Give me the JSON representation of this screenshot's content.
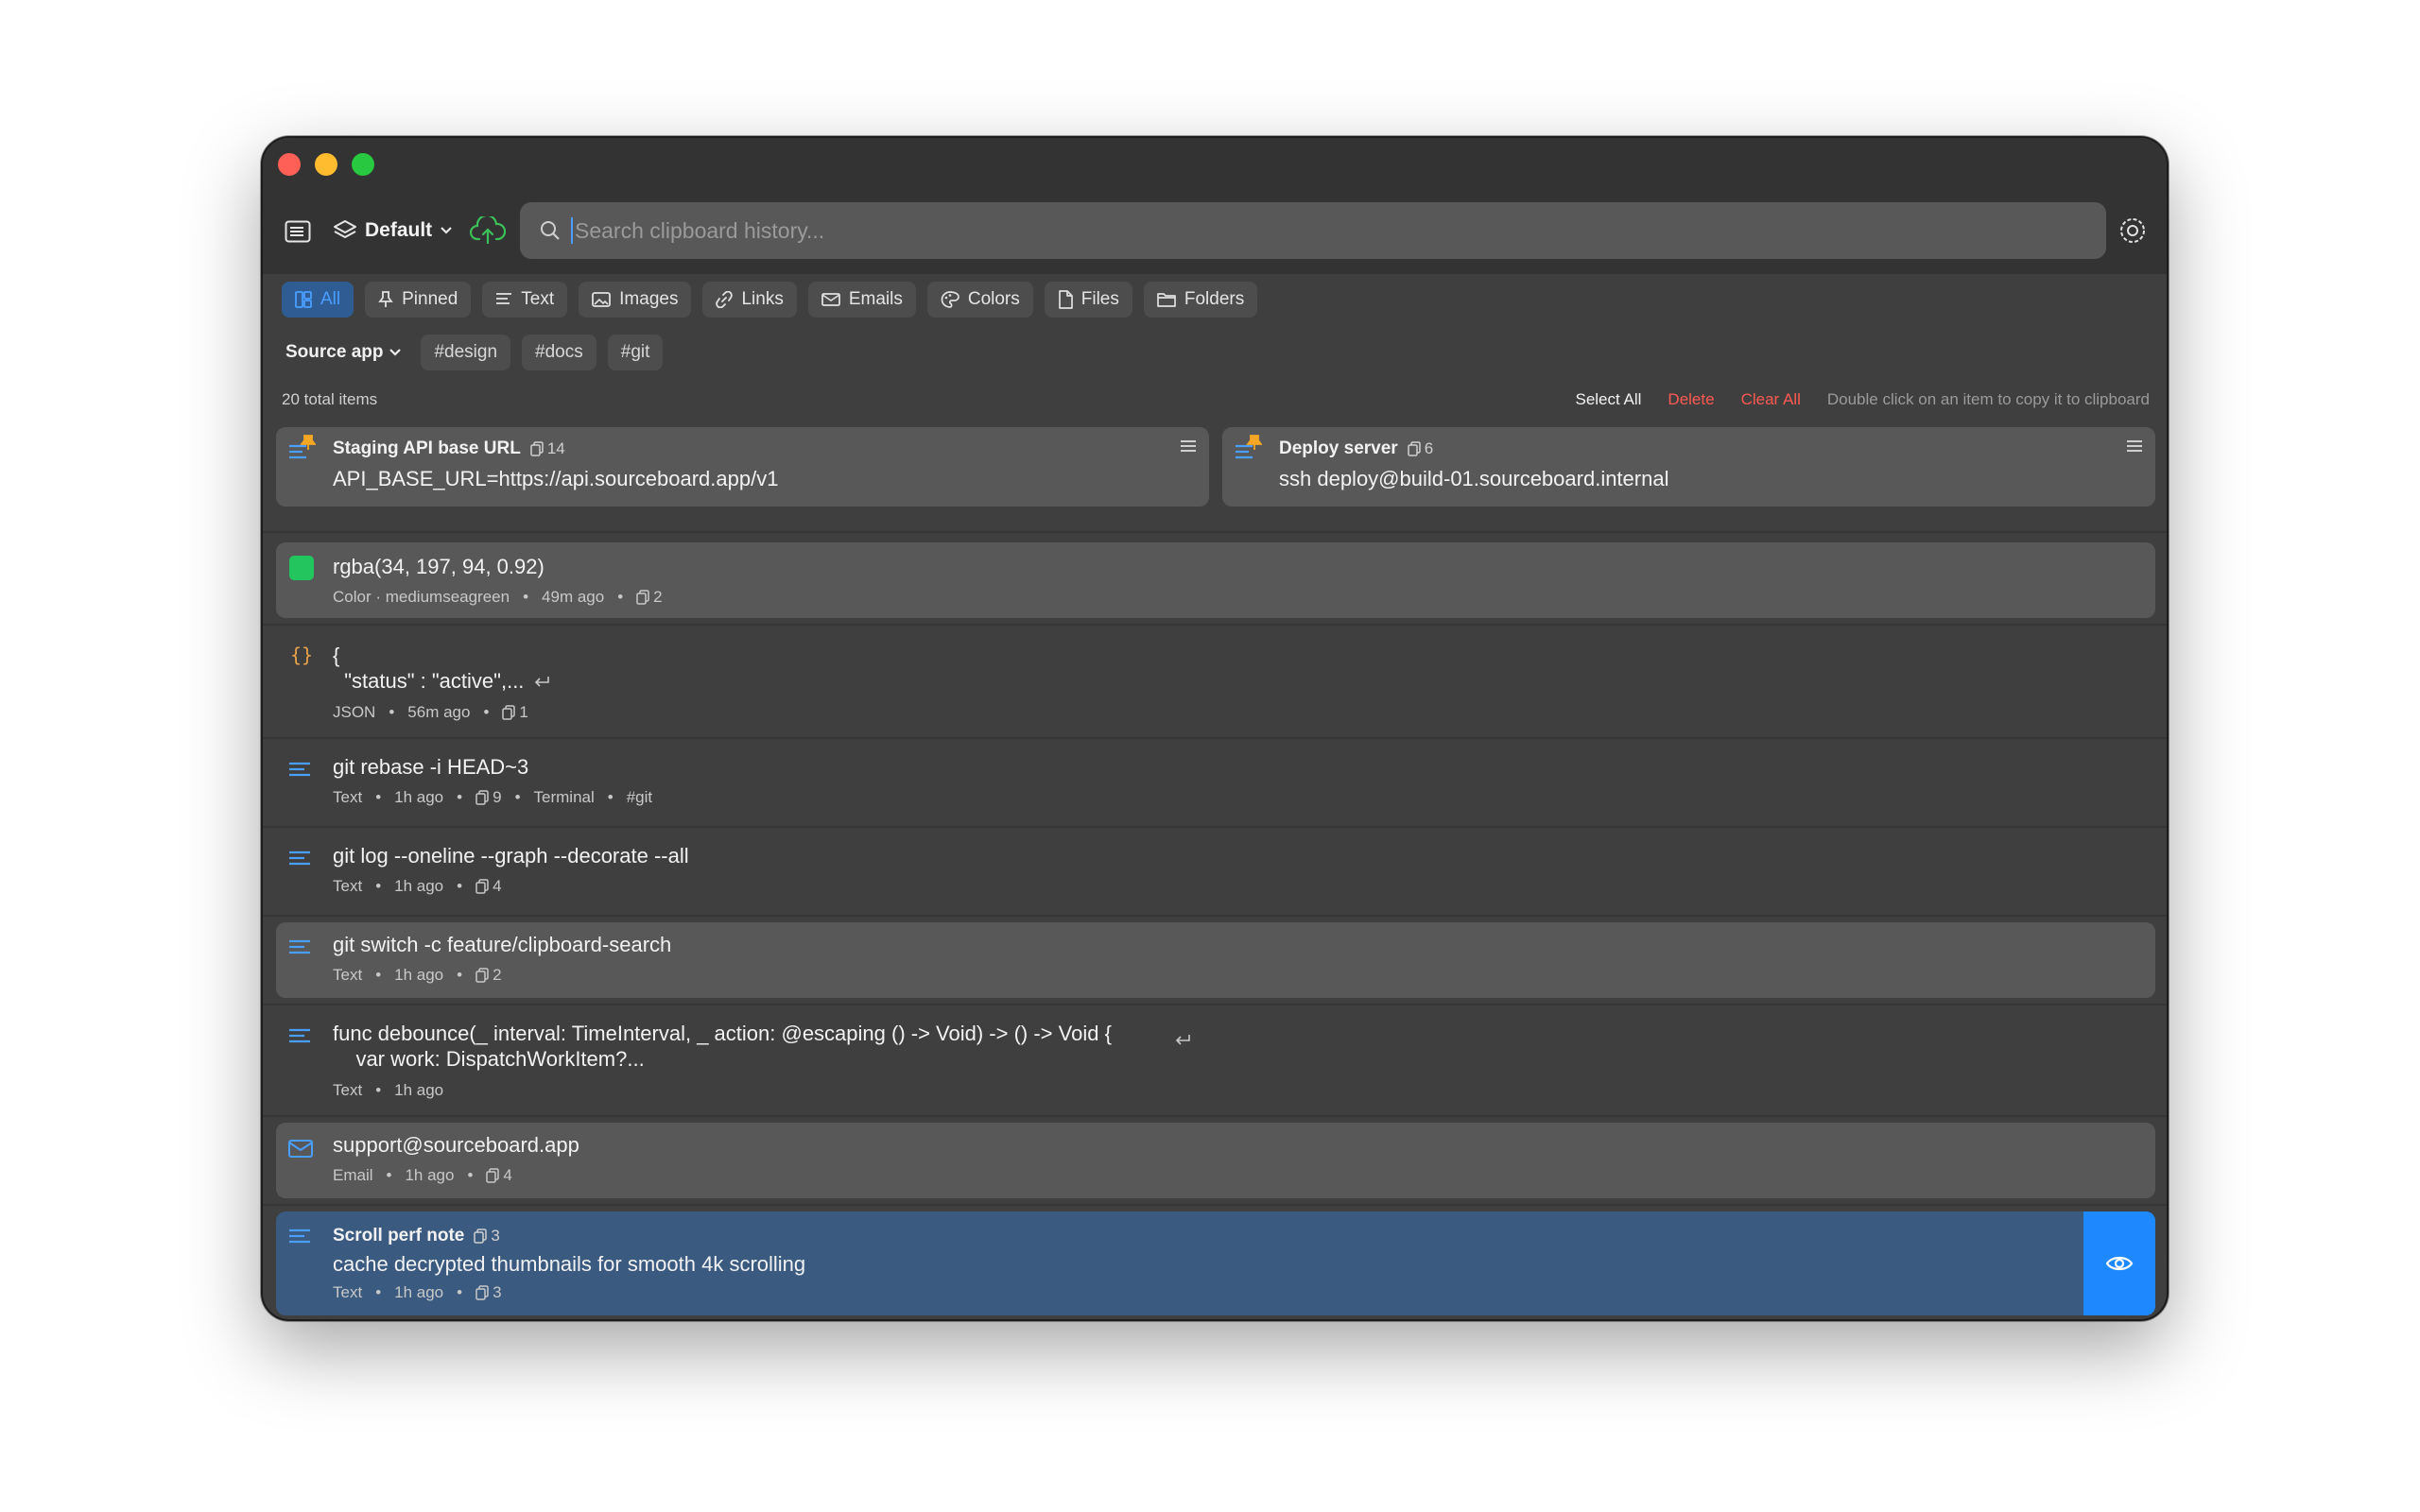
{
  "window": {
    "traffic_lights": [
      "close",
      "minimize",
      "maximize"
    ]
  },
  "toolbar": {
    "sidebar_icon": "sidebar-icon",
    "profile_label": "Default",
    "cloud_icon": "cloud-upload-icon",
    "search_placeholder": "Search clipboard history...",
    "settings_icon": "gear-icon"
  },
  "filters": [
    {
      "label": "All",
      "icon": "grid-icon",
      "active": true
    },
    {
      "label": "Pinned",
      "icon": "pin-icon",
      "active": false
    },
    {
      "label": "Text",
      "icon": "text-icon",
      "active": false
    },
    {
      "label": "Images",
      "icon": "image-icon",
      "active": false
    },
    {
      "label": "Links",
      "icon": "link-icon",
      "active": false
    },
    {
      "label": "Emails",
      "icon": "envelope-icon",
      "active": false
    },
    {
      "label": "Colors",
      "icon": "palette-icon",
      "active": false
    },
    {
      "label": "Files",
      "icon": "file-icon",
      "active": false
    },
    {
      "label": "Folders",
      "icon": "folder-icon",
      "active": false
    }
  ],
  "tags_bar": {
    "source_app": "Source app",
    "tags": [
      "#design",
      "#docs",
      "#git"
    ]
  },
  "status": {
    "total": "20 total items",
    "select_all": "Select All",
    "delete": "Delete",
    "clear_all": "Clear All",
    "hint": "Double click on an item to copy it to clipboard"
  },
  "pinned": [
    {
      "title": "Staging API base URL",
      "count": "14",
      "body": "API_BASE_URL=https://api.sourceboard.app/v1"
    },
    {
      "title": "Deploy server",
      "count": "6",
      "body": "ssh deploy@build-01.sourceboard.internal"
    }
  ],
  "items": [
    {
      "main": "rgba(34, 197, 94, 0.92)",
      "meta": [
        "Color · mediumseagreen",
        "49m ago"
      ],
      "count": "2",
      "color": "#22c55e"
    },
    {
      "main": "{\n  \"status\" : \"active\",...",
      "meta": [
        "JSON",
        "56m ago"
      ],
      "count": "1"
    },
    {
      "main": "git rebase -i HEAD~3",
      "meta": [
        "Text",
        "1h ago"
      ],
      "count": "9",
      "meta_after": [
        "Terminal",
        "#git"
      ]
    },
    {
      "main": "git log --oneline --graph --decorate --all",
      "meta": [
        "Text",
        "1h ago"
      ],
      "count": "4"
    },
    {
      "main": "git switch -c feature/clipboard-search",
      "meta": [
        "Text",
        "1h ago"
      ],
      "count": "2"
    },
    {
      "main": "func debounce(_ interval: TimeInterval, _ action: @escaping () -> Void) -> () -> Void {\n    var work: DispatchWorkItem?...",
      "meta": [
        "Text",
        "1h ago"
      ]
    },
    {
      "main": "support@sourceboard.app",
      "meta": [
        "Email",
        "1h ago"
      ],
      "count": "4"
    },
    {
      "title": "Scroll perf note",
      "title_count": "3",
      "main": "cache decrypted thumbnails for smooth 4k scrolling",
      "meta": [
        "Text",
        "1h ago"
      ],
      "count": "3"
    }
  ],
  "colors": {
    "accent": "#1e88ff",
    "selected_row": "#3a5a80",
    "danger": "#ff5a52",
    "pin": "#f5a623",
    "text_icon": "#4a9eff",
    "json_icon": "#e8a04a"
  }
}
